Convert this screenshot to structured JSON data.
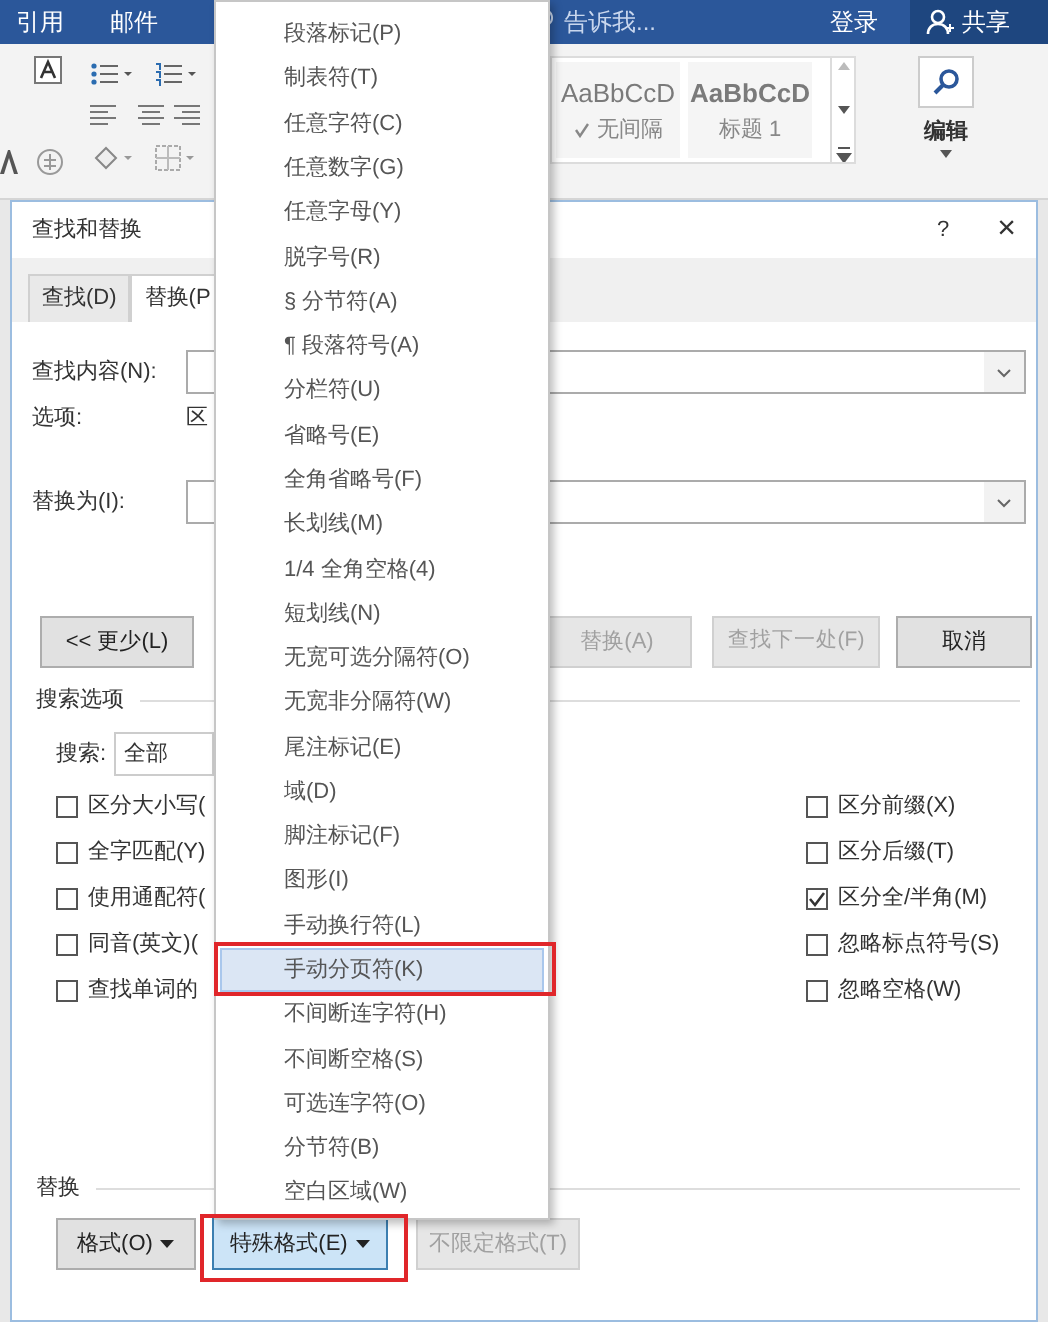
{
  "ribbon": {
    "tabs": [
      {
        "label": "引用"
      },
      {
        "label": "邮件"
      }
    ],
    "tell_me": "告诉我...",
    "sign_in": "登录",
    "share": "共享",
    "styles": [
      {
        "sample": "AaBbCcD",
        "name": "无间隔",
        "checked": true,
        "bold": false
      },
      {
        "sample": "AaBbCcD",
        "name": "标题 1",
        "checked": false,
        "bold": true
      }
    ],
    "editing": "编辑"
  },
  "dialog": {
    "title": "查找和替换",
    "help": "?",
    "close": "×",
    "tabs": [
      {
        "label": "查找(D)",
        "selected": false
      },
      {
        "label": "替换(P",
        "selected": true
      }
    ],
    "find_label": "查找内容(N):",
    "options_label": "选项:",
    "options_value": "区",
    "replace_label": "替换为(I):",
    "buttons": [
      {
        "label": "<< 更少(L)",
        "disabled": false
      },
      {
        "label": "替换(A)",
        "disabled": true
      },
      {
        "label": "查找下一处(F)",
        "disabled": true
      },
      {
        "label": "取消",
        "disabled": false
      }
    ],
    "search_options_heading": "搜索选项",
    "search_label": "搜索:",
    "search_value": "全部",
    "left_checks": [
      {
        "label": "区分大小写(",
        "checked": false
      },
      {
        "label": "全字匹配(Y)",
        "checked": false
      },
      {
        "label": "使用通配符(",
        "checked": false
      },
      {
        "label": "同音(英文)(",
        "checked": false
      },
      {
        "label": "查找单词的",
        "checked": false
      }
    ],
    "right_checks": [
      {
        "label": "区分前缀(X)",
        "checked": false
      },
      {
        "label": "区分后缀(T)",
        "checked": false
      },
      {
        "label": "区分全/半角(M)",
        "checked": true
      },
      {
        "label": "忽略标点符号(S)",
        "checked": false
      },
      {
        "label": "忽略空格(W)",
        "checked": false
      }
    ],
    "replace_heading": "替换",
    "bottom_buttons": [
      {
        "label": "格式(O)",
        "disabled": false,
        "pressed": false,
        "dropdown": true
      },
      {
        "label": "特殊格式(E)",
        "disabled": false,
        "pressed": true,
        "dropdown": true
      },
      {
        "label": "不限定格式(T)",
        "disabled": true,
        "pressed": false,
        "dropdown": false
      }
    ]
  },
  "menu": {
    "items": [
      {
        "label": "段落标记(P)",
        "selected": false
      },
      {
        "label": "制表符(T)",
        "selected": false
      },
      {
        "label": "任意字符(C)",
        "selected": false
      },
      {
        "label": "任意数字(G)",
        "selected": false
      },
      {
        "label": "任意字母(Y)",
        "selected": false
      },
      {
        "label": "脱字号(R)",
        "selected": false
      },
      {
        "label": "§ 分节符(A)",
        "selected": false
      },
      {
        "label": "¶ 段落符号(A)",
        "selected": false
      },
      {
        "label": "分栏符(U)",
        "selected": false
      },
      {
        "label": "省略号(E)",
        "selected": false
      },
      {
        "label": "全角省略号(F)",
        "selected": false
      },
      {
        "label": "长划线(M)",
        "selected": false
      },
      {
        "label": "1/4 全角空格(4)",
        "selected": false
      },
      {
        "label": "短划线(N)",
        "selected": false
      },
      {
        "label": "无宽可选分隔符(O)",
        "selected": false
      },
      {
        "label": "无宽非分隔符(W)",
        "selected": false
      },
      {
        "label": "尾注标记(E)",
        "selected": false
      },
      {
        "label": "域(D)",
        "selected": false
      },
      {
        "label": "脚注标记(F)",
        "selected": false
      },
      {
        "label": "图形(I)",
        "selected": false
      },
      {
        "label": "手动换行符(L)",
        "selected": false
      },
      {
        "label": "手动分页符(K)",
        "selected": true
      },
      {
        "label": "不间断连字符(H)",
        "selected": false
      },
      {
        "label": "不间断空格(S)",
        "selected": false
      },
      {
        "label": "可选连字符(O)",
        "selected": false
      },
      {
        "label": "分节符(B)",
        "selected": false
      },
      {
        "label": "空白区域(W)",
        "selected": false
      }
    ]
  }
}
